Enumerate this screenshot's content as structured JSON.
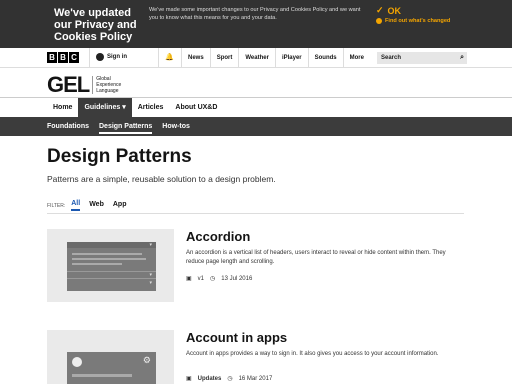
{
  "cookie": {
    "title": "We've updated our Privacy and Cookies Policy",
    "text": "We've made some important changes to our Privacy and Cookies Policy and we want you to know what this means for you and your data.",
    "ok_label": "OK",
    "find_label": "Find out what's changed",
    "accent": "#f4a500"
  },
  "masthead": {
    "logo_letters": [
      "B",
      "B",
      "C"
    ],
    "signin_label": "Sign in",
    "nav": [
      "News",
      "Sport",
      "Weather",
      "iPlayer",
      "Sounds",
      "More"
    ],
    "search_placeholder": "Search"
  },
  "gel": {
    "logo": "GEL",
    "subtitle_lines": [
      "Global",
      "Experience",
      "Language"
    ]
  },
  "primary_nav": {
    "items": [
      "Home",
      "Guidelines",
      "Articles",
      "About UX&D"
    ],
    "active": "Guidelines"
  },
  "sub_nav": {
    "items": [
      "Foundations",
      "Design Patterns",
      "How-tos"
    ],
    "active": "Design Patterns"
  },
  "page": {
    "title": "Design Patterns",
    "lead": "Patterns are a simple, reusable solution to a design problem."
  },
  "filter": {
    "label": "FILTER:",
    "options": [
      "All",
      "Web",
      "App"
    ],
    "active": "All"
  },
  "cards": [
    {
      "title": "Accordion",
      "description": "An accordion is a vertical list of headers, users interact to reveal or hide content within them. They reduce page length and scrolling.",
      "version": "v1",
      "date": "13 Jul 2016"
    },
    {
      "title": "Account in apps",
      "description": "Account in apps provides a way to sign in. It also gives you access to your account information.",
      "version": "Updates",
      "date": "16 Mar 2017"
    }
  ]
}
